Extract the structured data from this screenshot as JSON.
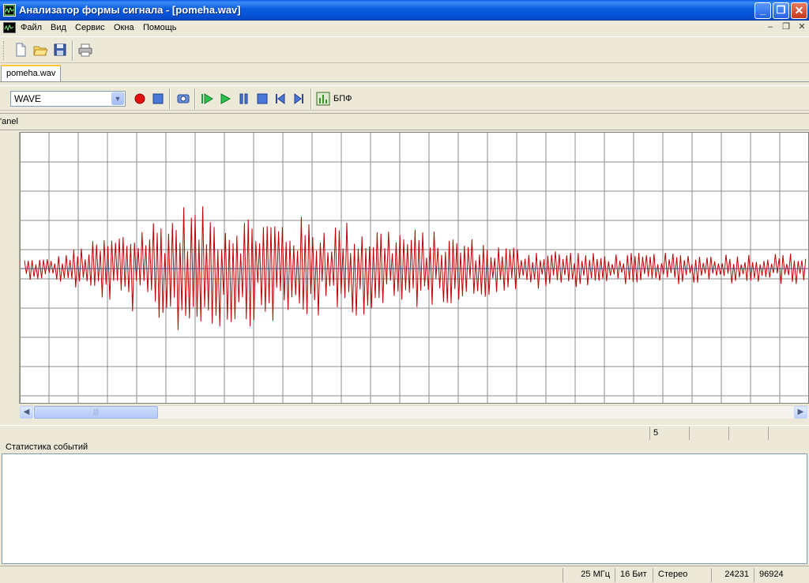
{
  "window": {
    "title": "Анализатор формы сигнала - [pomeha.wav]",
    "controls": {
      "minimize": "_",
      "maximize": "❐",
      "close": "✕"
    }
  },
  "menu": {
    "items": [
      {
        "label": "Файл",
        "accel": "Ф"
      },
      {
        "label": "Вид",
        "accel": "В"
      },
      {
        "label": "Сервис",
        "accel": "С"
      },
      {
        "label": "Окна",
        "accel": "О"
      },
      {
        "label": "Помощь",
        "accel": "П"
      }
    ],
    "mdi": {
      "minimize": "–",
      "restore": "❐",
      "close": "✕"
    }
  },
  "toolbar": {
    "icons": [
      "new-file-icon",
      "open-folder-icon",
      "save-icon",
      "print-icon"
    ]
  },
  "tabs": [
    {
      "label": "pomeha.wav",
      "active": true
    }
  ],
  "signal_toolbar": {
    "source_select": "WAVE",
    "fft_label": "БПФ",
    "icons": [
      "record-icon",
      "stop-icon",
      "capture-icon",
      "play-all-icon",
      "play-icon",
      "pause-icon",
      "stop-playback-icon",
      "skip-start-icon",
      "skip-end-icon",
      "fft-icon"
    ]
  },
  "panel_label": "'anel",
  "plot": {
    "grid": true,
    "line_color": "#c00000",
    "center_line_color": "#4a4a7a"
  },
  "status_row": {
    "value": "5"
  },
  "events": {
    "label": "Статистика событий"
  },
  "statusbar": {
    "frequency": "25 МГц",
    "bits": "16 Бит",
    "channels": "Стерео",
    "value1": "24231",
    "value2": "96924"
  },
  "colors": {
    "titlebar": "#0a5ce0",
    "chrome": "#ece9d8",
    "waveform": "#c00000"
  }
}
